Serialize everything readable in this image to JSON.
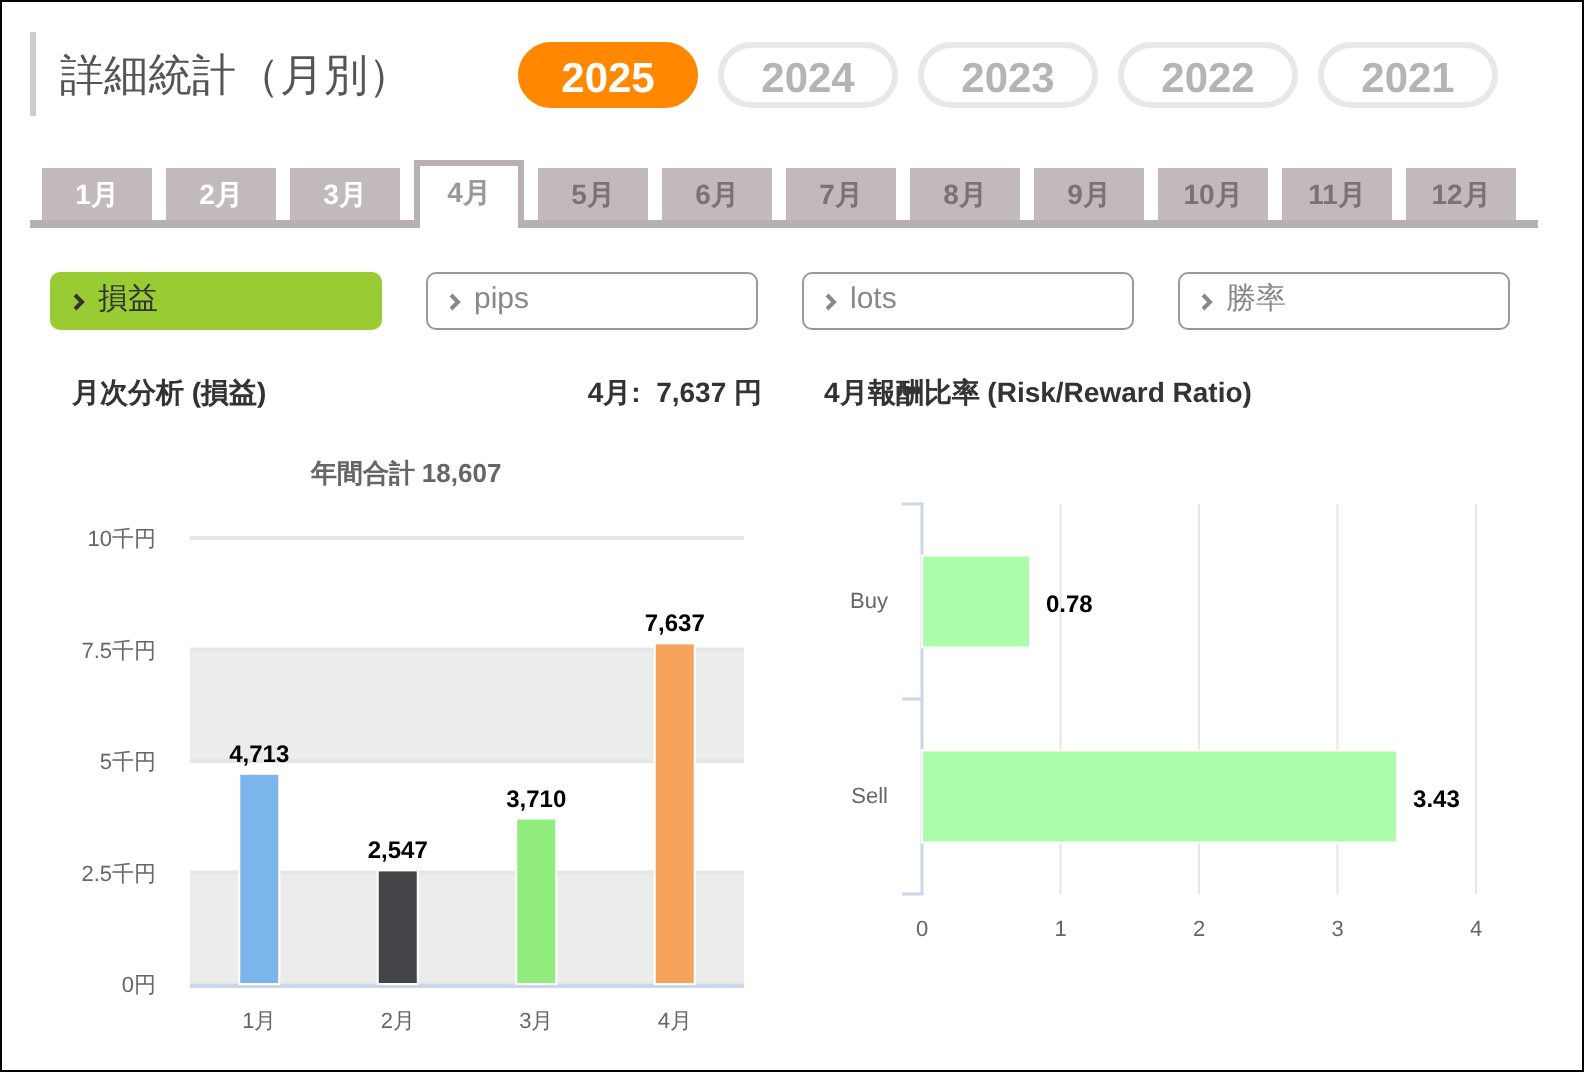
{
  "title": "詳細統計（月別）",
  "years": [
    {
      "label": "2025",
      "selected": true
    },
    {
      "label": "2024",
      "selected": false
    },
    {
      "label": "2023",
      "selected": false
    },
    {
      "label": "2022",
      "selected": false
    },
    {
      "label": "2021",
      "selected": false
    }
  ],
  "months": [
    {
      "label": "1月",
      "selected": false,
      "disabled": false
    },
    {
      "label": "2月",
      "selected": false,
      "disabled": false
    },
    {
      "label": "3月",
      "selected": false,
      "disabled": false
    },
    {
      "label": "4月",
      "selected": true,
      "disabled": false
    },
    {
      "label": "5月",
      "selected": false,
      "disabled": true
    },
    {
      "label": "6月",
      "selected": false,
      "disabled": true
    },
    {
      "label": "7月",
      "selected": false,
      "disabled": true
    },
    {
      "label": "8月",
      "selected": false,
      "disabled": true
    },
    {
      "label": "9月",
      "selected": false,
      "disabled": true
    },
    {
      "label": "10月",
      "selected": false,
      "disabled": true
    },
    {
      "label": "11月",
      "selected": false,
      "disabled": true
    },
    {
      "label": "12月",
      "selected": false,
      "disabled": true
    }
  ],
  "metrics": [
    {
      "label": "損益",
      "selected": true
    },
    {
      "label": "pips",
      "selected": false
    },
    {
      "label": "lots",
      "selected": false
    },
    {
      "label": "勝率",
      "selected": false
    }
  ],
  "monthly": {
    "heading": "月次分析 (損益)",
    "summary": "4月:  7,637 円",
    "chart_data": {
      "type": "bar",
      "title": "年間合計 18,607",
      "categories": [
        "1月",
        "2月",
        "3月",
        "4月"
      ],
      "series": [
        {
          "values": [
            4.713,
            2.547,
            3.71,
            7.637
          ]
        }
      ],
      "grid": true,
      "colors": [
        "#7cb5ec",
        "#434348",
        "#90ed7d",
        "#f7a35c"
      ],
      "ylim": [
        0,
        10
      ],
      "yticks": [
        {
          "value": 0,
          "label": "0円"
        },
        {
          "value": 2.5,
          "label": "2.5千円"
        },
        {
          "value": 5,
          "label": "5千円"
        },
        {
          "value": 7.5,
          "label": "7.5千円"
        },
        {
          "value": 10,
          "label": "10千円"
        }
      ],
      "value_labels": [
        "4,713",
        "2,547",
        "3,710",
        "7,637"
      ]
    }
  },
  "ratio": {
    "heading": "4月報酬比率 (Risk/Reward Ratio)",
    "chart_data": {
      "type": "bar",
      "orientation": "horizontal",
      "categories": [
        "Buy",
        "Sell"
      ],
      "series": [
        {
          "color": "#acfcac",
          "values": [
            0.78,
            3.43
          ]
        }
      ],
      "grid": true,
      "xlim": [
        0,
        4
      ],
      "xticks": [
        0,
        1,
        2,
        3,
        4
      ],
      "value_labels": [
        "0.78",
        "3.43"
      ]
    }
  }
}
